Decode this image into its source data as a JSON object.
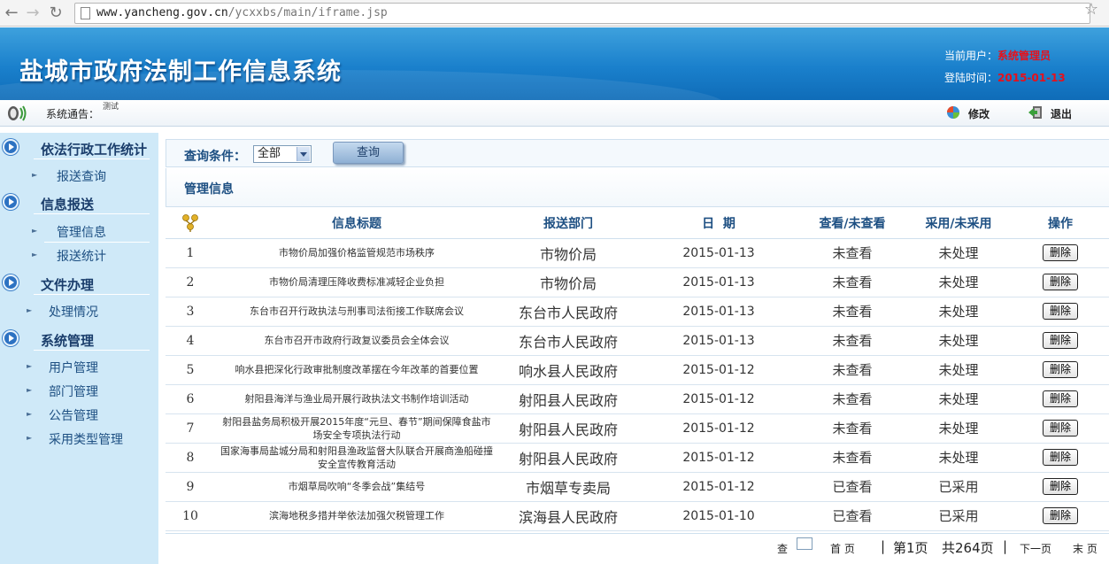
{
  "browser": {
    "url_host": "www.yancheng.gov.cn",
    "url_path": "/ycxxbs/main/iframe.jsp"
  },
  "header": {
    "title": "盐城市政府法制工作信息系统",
    "current_user_label": "当前用户：",
    "current_user": "系统管理员",
    "login_time_label": "登陆时间：",
    "login_time": "2015-01-13"
  },
  "notice": {
    "label": "系统通告：",
    "text": "测试"
  },
  "toolbar": {
    "edit_label": "修改",
    "logout_label": "退出"
  },
  "sidebar": {
    "groups": [
      {
        "label": "依法行政工作统计",
        "items": [
          "报送查询"
        ]
      },
      {
        "label": "信息报送",
        "items": [
          "管理信息",
          "报送统计"
        ]
      },
      {
        "label": "文件办理",
        "items": [
          "处理情况"
        ]
      },
      {
        "label": "系统管理",
        "items": [
          "用户管理",
          "部门管理",
          "公告管理",
          "采用类型管理"
        ]
      }
    ]
  },
  "query": {
    "label": "查询条件：",
    "selected": "全部",
    "button": "查询"
  },
  "section_title": "管理信息",
  "table": {
    "headers": [
      "信息标题",
      "报送部门",
      "日  期",
      "查看/未查看",
      "采用/未采用",
      "操作"
    ],
    "delete_label": "删除",
    "rows": [
      {
        "idx": "1",
        "title": "市物价局加强价格监管规范市场秩序",
        "dept": "市物价局",
        "date": "2015-01-13",
        "viewed": "未查看",
        "adopted": "未处理"
      },
      {
        "idx": "2",
        "title": "市物价局清理压降收费标准减轻企业负担",
        "dept": "市物价局",
        "date": "2015-01-13",
        "viewed": "未查看",
        "adopted": "未处理"
      },
      {
        "idx": "3",
        "title": "东台市召开行政执法与刑事司法衔接工作联席会议",
        "dept": "东台市人民政府",
        "date": "2015-01-13",
        "viewed": "未查看",
        "adopted": "未处理"
      },
      {
        "idx": "4",
        "title": "东台市召开市政府行政复议委员会全体会议",
        "dept": "东台市人民政府",
        "date": "2015-01-13",
        "viewed": "未查看",
        "adopted": "未处理"
      },
      {
        "idx": "5",
        "title": "响水县把深化行政审批制度改革摆在今年改革的首要位置",
        "dept": "响水县人民政府",
        "date": "2015-01-12",
        "viewed": "未查看",
        "adopted": "未处理"
      },
      {
        "idx": "6",
        "title": "射阳县海洋与渔业局开展行政执法文书制作培训活动",
        "dept": "射阳县人民政府",
        "date": "2015-01-12",
        "viewed": "未查看",
        "adopted": "未处理"
      },
      {
        "idx": "7",
        "title": "射阳县盐务局积极开展2015年度“元旦、春节”期间保障食盐市场安全专项执法行动",
        "dept": "射阳县人民政府",
        "date": "2015-01-12",
        "viewed": "未查看",
        "adopted": "未处理"
      },
      {
        "idx": "8",
        "title": "国家海事局盐城分局和射阳县渔政监督大队联合开展商渔船碰撞安全宣传教育活动",
        "dept": "射阳县人民政府",
        "date": "2015-01-12",
        "viewed": "未查看",
        "adopted": "未处理"
      },
      {
        "idx": "9",
        "title": "市烟草局吹响“冬季会战”集结号",
        "dept": "市烟草专卖局",
        "date": "2015-01-12",
        "viewed": "已查看",
        "adopted": "已采用"
      },
      {
        "idx": "10",
        "title": "滨海地税多措并举依法加强欠税管理工作",
        "dept": "滨海县人民政府",
        "date": "2015-01-10",
        "viewed": "已查看",
        "adopted": "已采用"
      }
    ]
  },
  "pager": {
    "search_label": "查",
    "first": "首 页",
    "current": "第1页",
    "total": "共264页",
    "next": "下一页",
    "last": "末 页"
  },
  "colors": {
    "banner": "#1a80cc",
    "sidebar": "#cfe9f8",
    "accent_text": "#1d4f82",
    "user_highlight": "#e8101a"
  }
}
